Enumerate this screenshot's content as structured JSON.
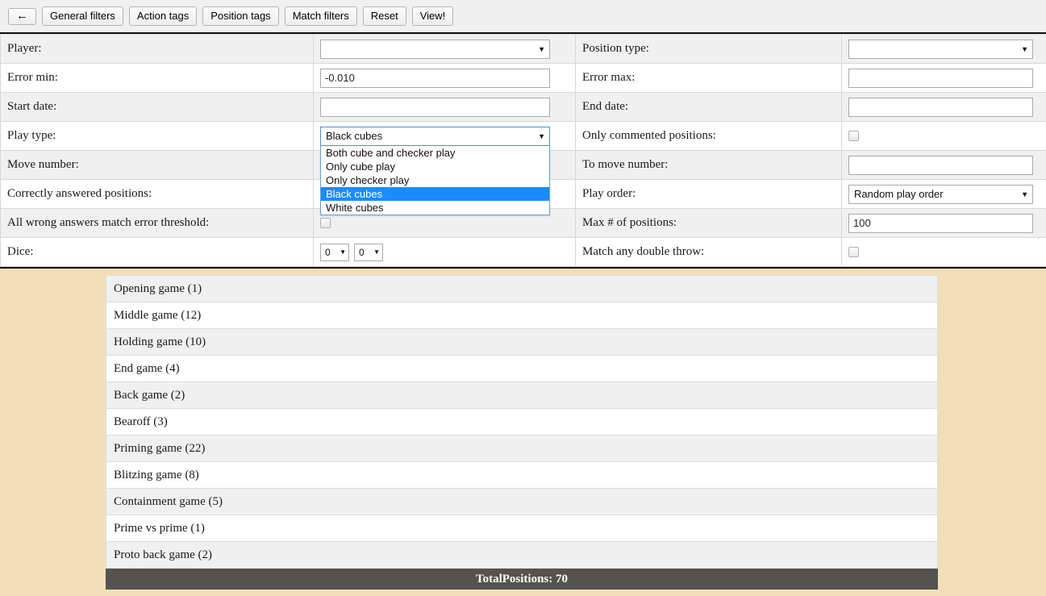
{
  "toolbar": {
    "back_icon": "left-arrow-icon",
    "back_label": "←",
    "buttons": [
      "General filters",
      "Action tags",
      "Position tags",
      "Match filters",
      "Reset",
      "View!"
    ]
  },
  "filters": {
    "rows": [
      {
        "left_label": "Player:",
        "left_control": {
          "type": "select",
          "value": ""
        },
        "right_label": "Position type:",
        "right_control": {
          "type": "select",
          "value": ""
        }
      },
      {
        "left_label": "Error min:",
        "left_control": {
          "type": "text",
          "value": "-0.010",
          "placeholder": ""
        },
        "right_label": "Error max:",
        "right_control": {
          "type": "text",
          "value": "",
          "placeholder": ""
        }
      },
      {
        "left_label": "Start date:",
        "left_control": {
          "type": "text",
          "value": "",
          "placeholder": ""
        },
        "right_label": "End date:",
        "right_control": {
          "type": "text",
          "value": "",
          "placeholder": ""
        }
      },
      {
        "left_label": "Play type:",
        "left_control": {
          "type": "select-open",
          "value": "Black cubes",
          "options": [
            "Both cube and checker play",
            "Only  cube play",
            "Only checker play",
            "Black cubes",
            "White cubes"
          ],
          "selected_index": 3
        },
        "right_label": "Only commented positions:",
        "right_control": {
          "type": "checkbox",
          "checked": false
        }
      },
      {
        "left_label": "Move number:",
        "left_control": {
          "type": "text",
          "value": "",
          "placeholder": ""
        },
        "right_label": "To move number:",
        "right_control": {
          "type": "text",
          "value": "",
          "placeholder": ""
        }
      },
      {
        "left_label": "Correctly answered positions:",
        "left_control": {
          "type": "select",
          "value": ""
        },
        "right_label": "Play order:",
        "right_control": {
          "type": "select",
          "value": "Random play order"
        }
      },
      {
        "left_label": "All wrong answers match error threshold:",
        "left_control": {
          "type": "checkbox",
          "checked": false
        },
        "right_label": "Max # of positions:",
        "right_control": {
          "type": "text",
          "value": "100",
          "placeholder": ""
        }
      },
      {
        "left_label": "Dice:",
        "left_control": {
          "type": "dice",
          "die1": "0",
          "die2": "0"
        },
        "right_label": "Match any double throw:",
        "right_control": {
          "type": "checkbox",
          "checked": false
        }
      }
    ]
  },
  "tag_list": {
    "items": [
      "Opening game (1)",
      "Middle game (12)",
      "Holding game (10)",
      "End game (4)",
      "Back game (2)",
      "Bearoff (3)",
      "Priming game (22)",
      "Blitzing game (8)",
      "Containment game (5)",
      "Prime vs prime (1)",
      "Proto back game (2)"
    ],
    "total_label": "TotalPositions: 70"
  },
  "colors": {
    "page_background": "#f2dfba",
    "highlight": "#1a8cff",
    "total_bar": "#555350",
    "row_stripe": "#f0f0f0"
  }
}
